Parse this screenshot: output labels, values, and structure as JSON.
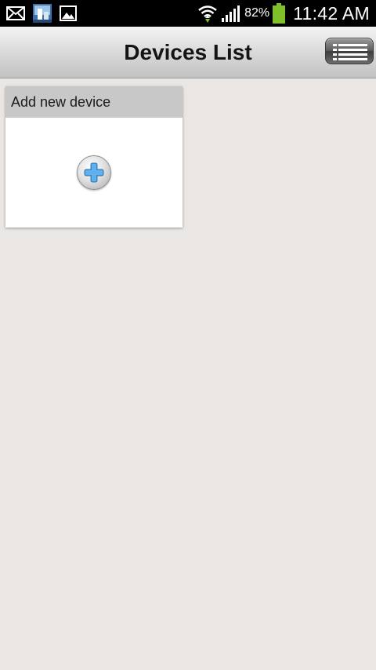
{
  "status_bar": {
    "icons": [
      "email-icon",
      "app-thumbnail-icon",
      "gallery-icon",
      "wifi-icon",
      "signal-icon",
      "battery-icon"
    ],
    "battery": "82%",
    "time": "11:42 AM",
    "battery_color": "#7fbf2a"
  },
  "header": {
    "title": "Devices List",
    "menu_icon": "list-menu-icon"
  },
  "card": {
    "label": "Add new device",
    "icon": "plus-icon",
    "accent": "#4a9fe0"
  }
}
